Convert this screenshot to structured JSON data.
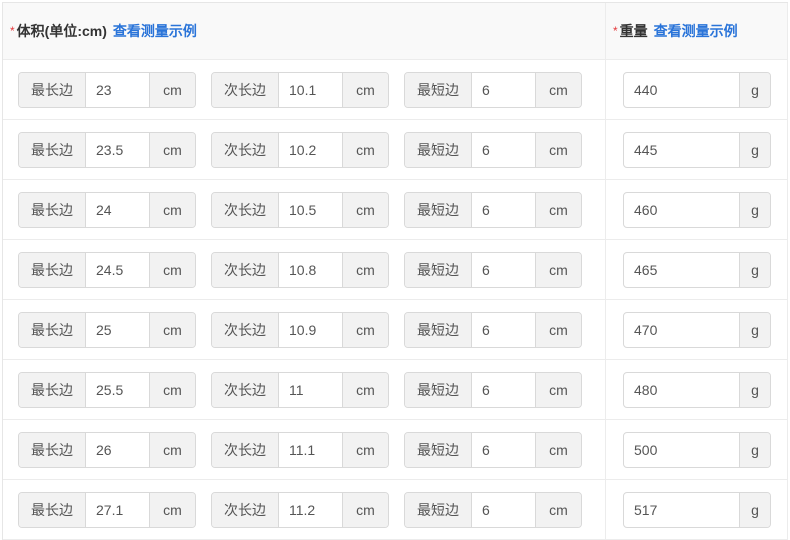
{
  "header": {
    "required_mark": "*",
    "volume_label": "体积(单位:cm)",
    "volume_link": "查看测量示例",
    "weight_label": "重量",
    "weight_link": "查看测量示例"
  },
  "labels": {
    "longest": "最长边",
    "second": "次长边",
    "shortest": "最短边",
    "cm": "cm",
    "g": "g"
  },
  "rows": [
    {
      "longest": "23",
      "second": "10.1",
      "shortest": "6",
      "weight": "440"
    },
    {
      "longest": "23.5",
      "second": "10.2",
      "shortest": "6",
      "weight": "445"
    },
    {
      "longest": "24",
      "second": "10.5",
      "shortest": "6",
      "weight": "460"
    },
    {
      "longest": "24.5",
      "second": "10.8",
      "shortest": "6",
      "weight": "465"
    },
    {
      "longest": "25",
      "second": "10.9",
      "shortest": "6",
      "weight": "470"
    },
    {
      "longest": "25.5",
      "second": "11",
      "shortest": "6",
      "weight": "480"
    },
    {
      "longest": "26",
      "second": "11.1",
      "shortest": "6",
      "weight": "500"
    },
    {
      "longest": "27.1",
      "second": "11.2",
      "shortest": "6",
      "weight": "517"
    }
  ]
}
